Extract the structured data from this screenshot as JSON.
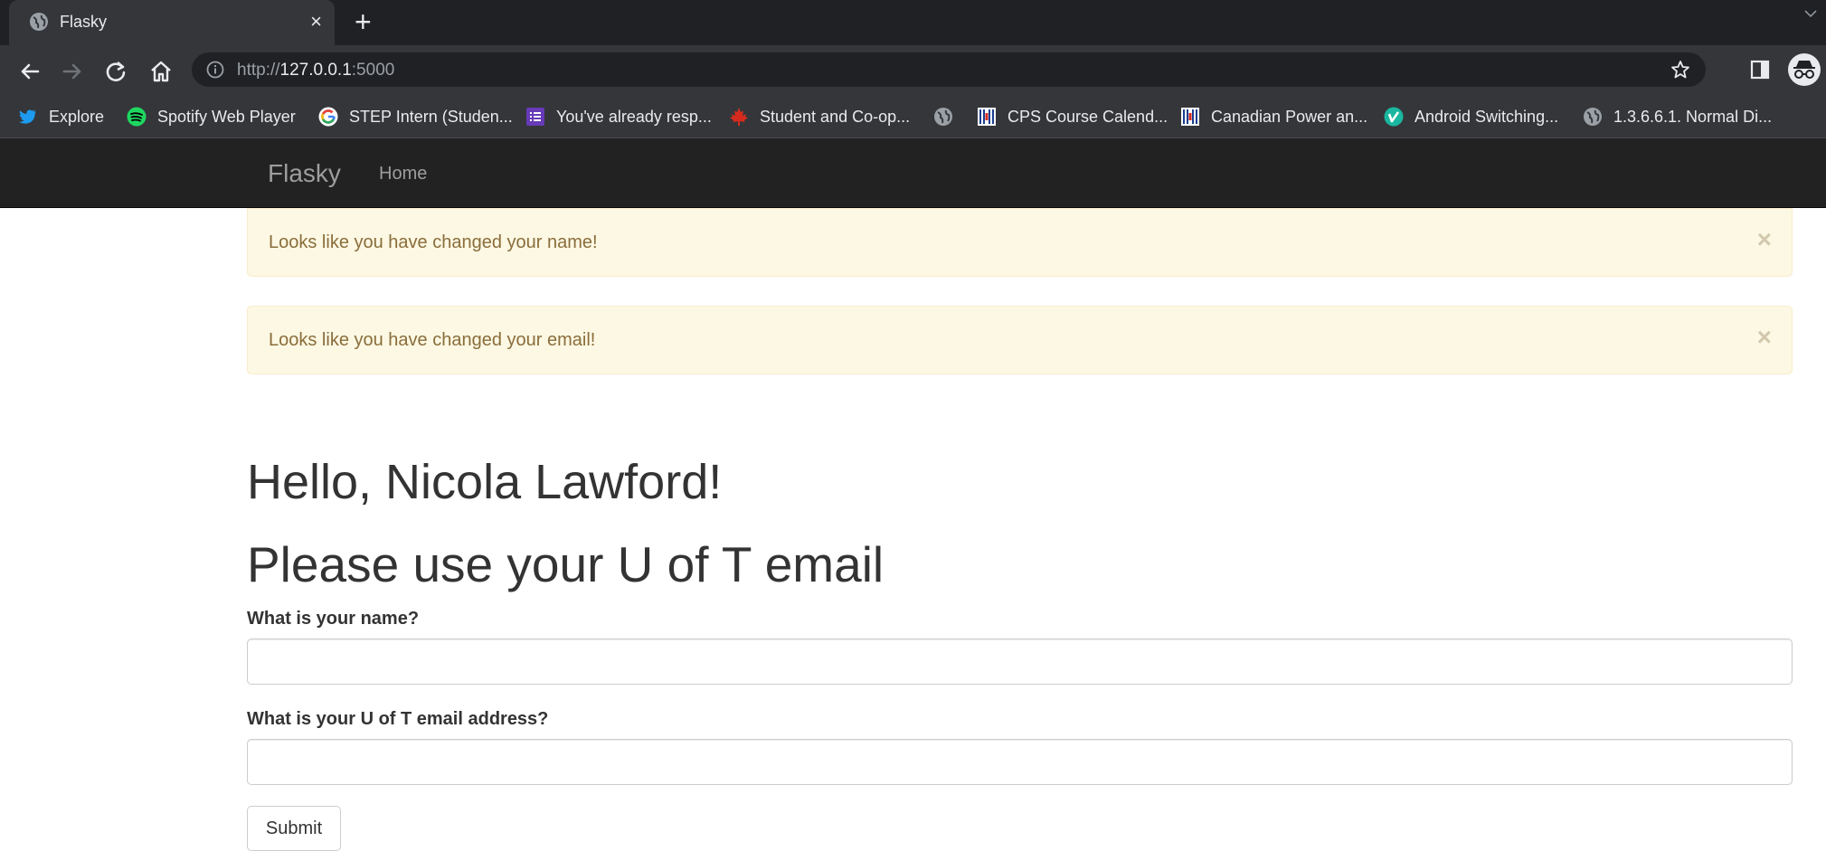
{
  "browser": {
    "tab": {
      "title": "Flasky",
      "close_glyph": "×",
      "favicon": "globe-icon"
    },
    "new_tab_glyph": "+",
    "url": {
      "scheme": "http://",
      "host": "127.0.0.1",
      "port": ":5000"
    },
    "bookmarks": [
      {
        "label": "Explore",
        "icon": "twitter-icon"
      },
      {
        "label": "Spotify Web Player",
        "icon": "spotify-icon"
      },
      {
        "label": "STEP Intern (Studen...",
        "icon": "google-icon"
      },
      {
        "label": "You've already resp...",
        "icon": "forms-icon"
      },
      {
        "label": "Student and Co-op...",
        "icon": "maple-leaf-icon"
      },
      {
        "label": "",
        "icon": "globe-icon"
      },
      {
        "label": "CPS Course Calend...",
        "icon": "calendar-icon"
      },
      {
        "label": "Canadian Power an...",
        "icon": "calendar-icon"
      },
      {
        "label": "Android Switching...",
        "icon": "vimeo-icon"
      },
      {
        "label": "1.3.6.6.1. Normal Di...",
        "icon": "globe-icon"
      }
    ]
  },
  "navbar": {
    "brand": "Flasky",
    "home": "Home"
  },
  "alerts": [
    {
      "message": "Looks like you have changed your name!",
      "close": "×"
    },
    {
      "message": "Looks like you have changed your email!",
      "close": "×"
    }
  ],
  "page": {
    "greeting": "Hello, Nicola Lawford!",
    "notice": "Please use your U of T email"
  },
  "form": {
    "name_label": "What is your name?",
    "name_value": "",
    "email_label": "What is your U of T email address?",
    "email_value": "",
    "submit_label": "Submit"
  },
  "colors": {
    "chrome_dark": "#202124",
    "chrome_toolbar": "#35363a",
    "navbar_bg": "#222222",
    "alert_bg": "#fcf8e3",
    "alert_text": "#8a6d3b"
  }
}
